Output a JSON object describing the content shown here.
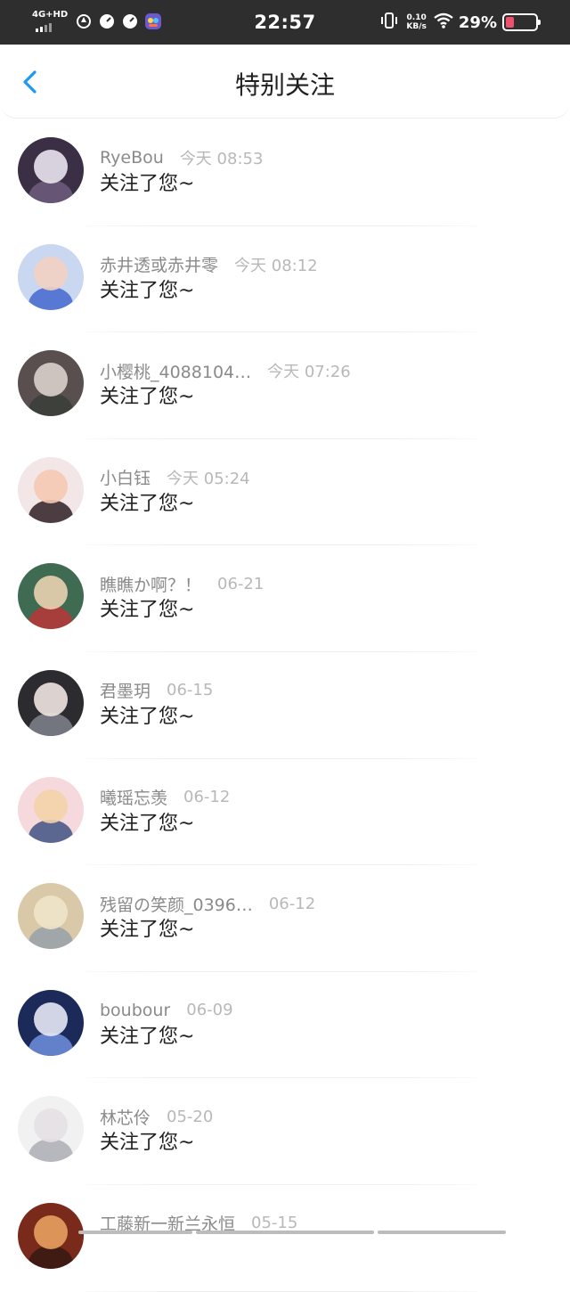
{
  "status_bar": {
    "network": "4G+HD",
    "time": "22:57",
    "speed_value": "0.10",
    "speed_unit": "KB/s",
    "battery_percent": "29%",
    "battery_level": 0.29,
    "icons": [
      "signal-icon",
      "sync-icon",
      "speedometer-icon",
      "speedometer-icon",
      "app-icon",
      "vibrate-icon",
      "wifi-icon",
      "battery-icon"
    ]
  },
  "header": {
    "title": "特别关注",
    "back_icon": "chevron-left-icon",
    "accent": "#1a9af7"
  },
  "items": [
    {
      "name": "RyeBou",
      "time": "今天 08:53",
      "message": "关注了您~",
      "avatar": [
        "#3a2f44",
        "#e9e4ef",
        "#6b5a7a"
      ]
    },
    {
      "name": "赤井透或赤井零",
      "time": "今天 08:12",
      "message": "关注了您~",
      "avatar": [
        "#c9d7f0",
        "#f2d2c2",
        "#4a6fd0"
      ]
    },
    {
      "name": "小樱桃_4088104…",
      "time": "今天 07:26",
      "message": "关注了您~",
      "avatar": [
        "#5a4f4f",
        "#d9cfcb",
        "#3b3f38"
      ]
    },
    {
      "name": "小白钰",
      "time": "今天 05:24",
      "message": "关注了您~",
      "avatar": [
        "#f3e6e6",
        "#f4c9b2",
        "#3a2a30"
      ]
    },
    {
      "name": "瞧瞧か啊？！",
      "time": "06-21",
      "message": "关注了您~",
      "avatar": [
        "#3f6b52",
        "#ead3b0",
        "#b43a3a"
      ]
    },
    {
      "name": "君墨玥",
      "time": "06-15",
      "message": "关注了您~",
      "avatar": [
        "#2b2b30",
        "#efe5e2",
        "#7b7e88"
      ]
    },
    {
      "name": "曦瑶忘羡",
      "time": "06-12",
      "message": "关注了您~",
      "avatar": [
        "#f5d9dd",
        "#f3d3a8",
        "#4a5a88"
      ]
    },
    {
      "name": "残留の笑颜_0396…",
      "time": "06-12",
      "message": "关注了您~",
      "avatar": [
        "#d9c9a8",
        "#f0e4c9",
        "#9aa3a8"
      ]
    },
    {
      "name": "boubour",
      "time": "06-09",
      "message": "关注了您~",
      "avatar": [
        "#1c2a5a",
        "#e6e8f5",
        "#6c8ad6"
      ]
    },
    {
      "name": "林芯伶",
      "time": "05-20",
      "message": "关注了您~",
      "avatar": [
        "#f1f1f1",
        "#e5e0e3",
        "#b0b0b8"
      ]
    },
    {
      "name": "工藤新一新兰永恒",
      "time": "05-15",
      "message": "",
      "avatar": [
        "#7a2a1a",
        "#e8a060",
        "#3a1a14"
      ]
    }
  ]
}
